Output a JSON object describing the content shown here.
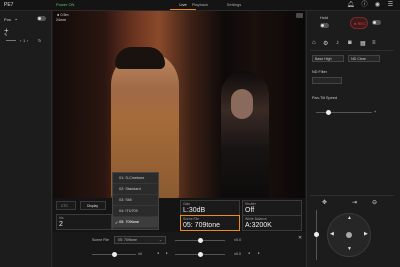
{
  "topbar": {
    "device_name": "PE7",
    "power_status": "Power ON",
    "tabs": [
      {
        "label": "Live",
        "active": true
      },
      {
        "label": "Playback",
        "active": false
      },
      {
        "label": "Settings",
        "active": false
      }
    ],
    "accent_color": "#f08a1c",
    "icons": [
      "bell-icon",
      "info-icon",
      "user-icon",
      "menu-icon"
    ]
  },
  "left_panel": {
    "preset_label": "Pos",
    "zoom_value": "1"
  },
  "video": {
    "rec_info": [
      "◄ 0.5m",
      "24mm"
    ]
  },
  "scene_file_dropdown": {
    "options": [
      {
        "label": "01: S-Cinetone",
        "selected": false
      },
      {
        "label": "02: Standard",
        "selected": false
      },
      {
        "label": "03: Still",
        "selected": false
      },
      {
        "label": "04: ITU709",
        "selected": false
      },
      {
        "label": "05: 709tone",
        "selected": true
      }
    ]
  },
  "param_strip": {
    "cc_label": "CTC",
    "display_label": "Display",
    "iris": {
      "label": "Iris",
      "value": "2"
    },
    "gain": {
      "label": "Gain",
      "value": "L:30dB"
    },
    "shutter": {
      "label": "Shutter",
      "value": "Off"
    },
    "scene_file": {
      "label": "Scene File",
      "value": "05: 709tone"
    },
    "white_balance": {
      "label": "White Balance",
      "value": "A:3200K"
    }
  },
  "bottom_controls": {
    "scene_file_label": "Scene File",
    "scene_file_value": "05: 709tone",
    "close_glyph": "✕",
    "left_value": "±0",
    "mid_value": "±0.0",
    "right_value": "±0.0",
    "sliders": [
      {
        "name": "black",
        "level": 0.5
      },
      {
        "name": "gamma",
        "level": 0.5
      },
      {
        "name": "knee",
        "level": 0.5
      }
    ]
  },
  "right_panel": {
    "hold_label": "Hold",
    "rec_label": "● REC",
    "select_1": "Base High",
    "select_2": "ND Clear",
    "nd_filter_label": "ND Filter",
    "pan_tilt_label": "Pan-Tilt Speed",
    "pan_tilt_level": 0.2
  }
}
